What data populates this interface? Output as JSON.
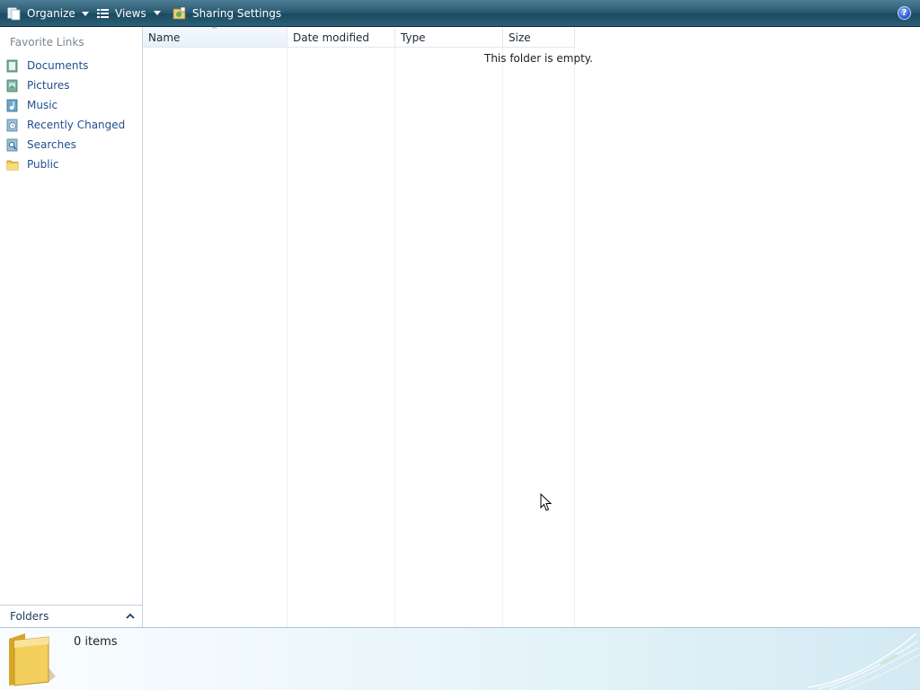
{
  "toolbar": {
    "organize_label": "Organize",
    "views_label": "Views",
    "sharing_label": "Sharing Settings",
    "help_glyph": "?"
  },
  "nav": {
    "title": "Favorite Links",
    "items": [
      {
        "label": "Documents",
        "icon": "documents-icon"
      },
      {
        "label": "Pictures",
        "icon": "pictures-icon"
      },
      {
        "label": "Music",
        "icon": "music-icon"
      },
      {
        "label": "Recently Changed",
        "icon": "recently-changed-icon"
      },
      {
        "label": "Searches",
        "icon": "searches-icon"
      },
      {
        "label": "Public",
        "icon": "public-folder-icon"
      }
    ],
    "folders_label": "Folders"
  },
  "columns": {
    "name": "Name",
    "date_modified": "Date modified",
    "type": "Type",
    "size": "Size",
    "sorted_by": "Name"
  },
  "content": {
    "empty_message": "This folder is empty."
  },
  "details": {
    "item_count": "0 items"
  },
  "colors": {
    "toolbar": "#2c5c73",
    "link": "#1f4f8f",
    "details_pane": "#eaf6fb"
  }
}
